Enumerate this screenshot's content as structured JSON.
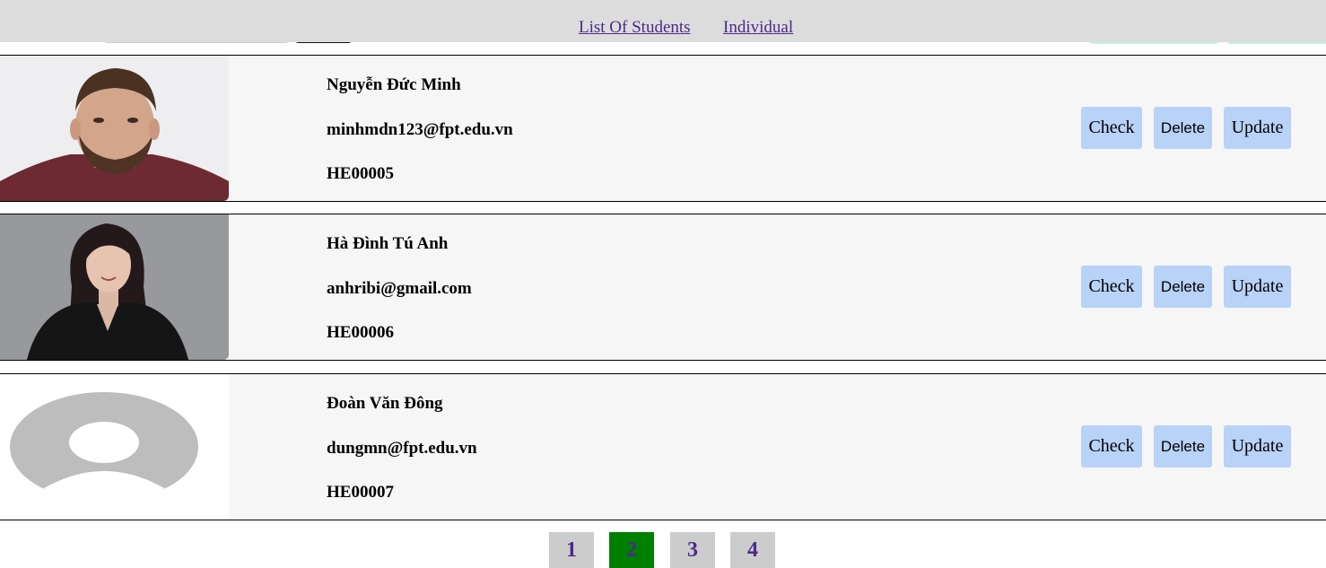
{
  "nav": {
    "links": [
      "List Of Students",
      "Individual"
    ]
  },
  "students": [
    {
      "name": "Nguyễn Đức Minh",
      "email": "minhmdn123@fpt.edu.vn",
      "id": "HE00005",
      "photo": "man-portrait"
    },
    {
      "name": "Hà Đình Tú Anh",
      "email": "anhribi@gmail.com",
      "id": "HE00006",
      "photo": "woman-portrait"
    },
    {
      "name": "Đoàn Văn Đông",
      "email": "dungmn@fpt.edu.vn",
      "id": "HE00007",
      "photo": "default-avatar"
    }
  ],
  "actions": {
    "check": "Check",
    "delete": "Delete",
    "update": "Update"
  },
  "pagination": {
    "pages": [
      "1",
      "2",
      "3",
      "4"
    ],
    "active": "2"
  },
  "colors": {
    "header_bg": "#dcdcdc",
    "link": "#4b2a8a",
    "button_bg": "#b9d2f7",
    "active_page": "#008000",
    "page_bg": "#cccccc"
  }
}
